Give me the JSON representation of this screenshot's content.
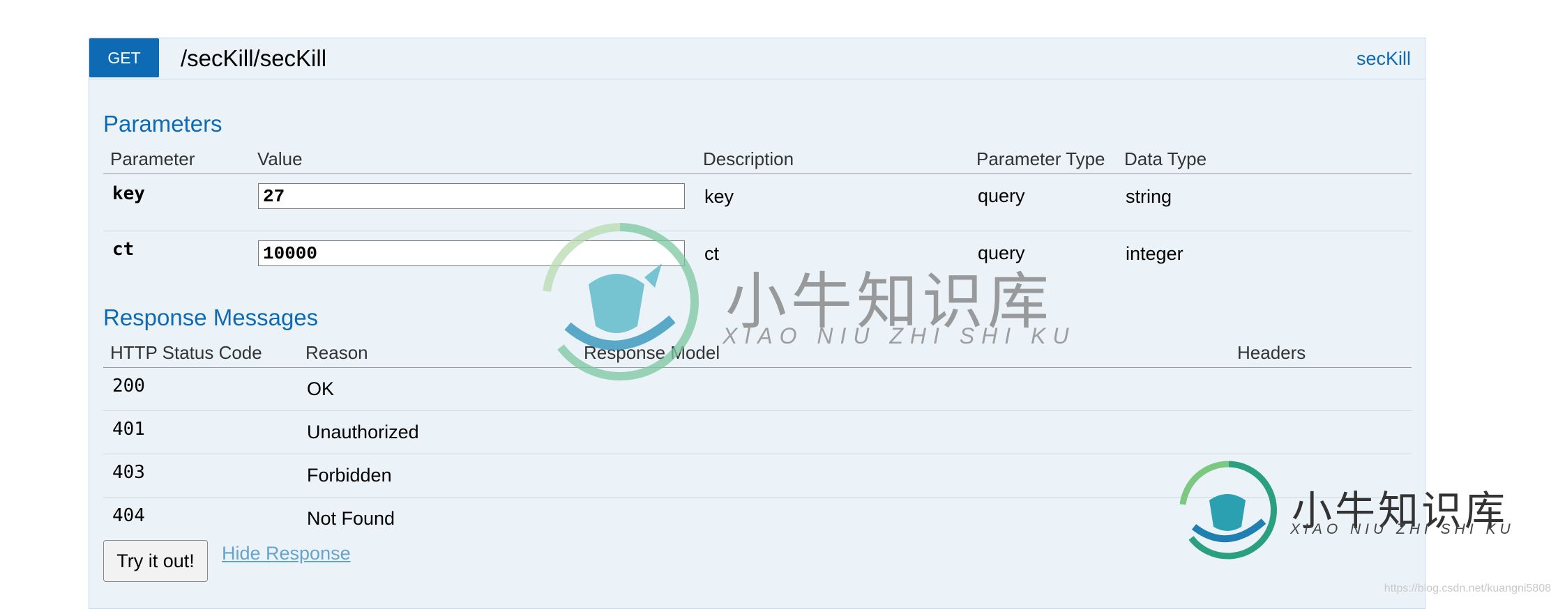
{
  "operation": {
    "method": "GET",
    "path": "/secKill/secKill",
    "tag": "secKill"
  },
  "parameters": {
    "title": "Parameters",
    "headers": {
      "parameter": "Parameter",
      "value": "Value",
      "description": "Description",
      "param_type": "Parameter Type",
      "data_type": "Data Type"
    },
    "rows": [
      {
        "name": "key",
        "value": "27",
        "description": "key",
        "param_type": "query",
        "data_type": "string"
      },
      {
        "name": "ct",
        "value": "10000",
        "description": "ct",
        "param_type": "query",
        "data_type": "integer"
      }
    ]
  },
  "responses": {
    "title": "Response Messages",
    "headers": {
      "status": "HTTP Status Code",
      "reason": "Reason",
      "model": "Response Model",
      "headers": "Headers"
    },
    "rows": [
      {
        "code": "200",
        "reason": "OK"
      },
      {
        "code": "401",
        "reason": "Unauthorized"
      },
      {
        "code": "403",
        "reason": "Forbidden"
      },
      {
        "code": "404",
        "reason": "Not Found"
      }
    ]
  },
  "actions": {
    "try_label": "Try it out!",
    "hide_label": "Hide Response"
  },
  "watermark": {
    "cn": "小牛知识库",
    "en": "XIAO NIU ZHI SHI KU",
    "url": "https://blog.csdn.net/kuangni5808"
  },
  "colors": {
    "method_bg": "#0f6ab4",
    "panel_bg": "#ebf3f9",
    "heading_blue": "#0f6ab4",
    "link_light": "#66a3cc"
  }
}
